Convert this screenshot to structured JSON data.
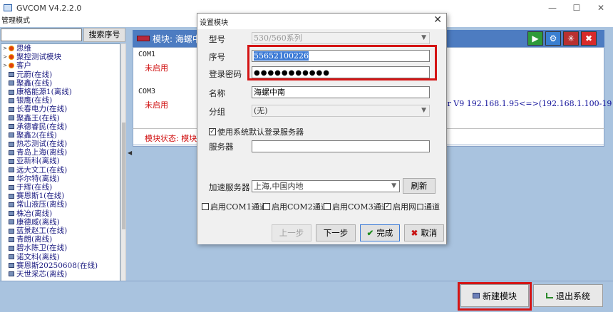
{
  "window": {
    "title": "GVCOM V4.2.2.0",
    "minimize": "—",
    "maximize": "☐",
    "close": "✕"
  },
  "menu": {
    "manage_mode": "管理模式"
  },
  "search": {
    "placeholder": "",
    "button": "搜索序号"
  },
  "tree": {
    "groups": [
      "思维",
      "聚控测试模块",
      "客户"
    ],
    "devices": [
      "元蔚(在线)",
      "聚鑫(在线)",
      "康格能源1(离线)",
      "银鹰(在线)",
      "长春电力(在线)",
      "聚鑫王(在线)",
      "承德睿民(在线)",
      "聚鑫2(在线)",
      "热芯测试(在线)",
      "青岛上海(离线)",
      "亚新科(离线)",
      "远大文工(在线)",
      "华尔特(离线)",
      "于辉(在线)",
      "赛恩斯1(在线)",
      "常山液压(离线)",
      "株冶(离线)",
      "康德威(离线)",
      "蓝景赵工(在线)",
      "青朗(离线)",
      "碧水陈卫(在线)",
      "诺文科(离线)",
      "赛恩斯20250608(在线)",
      "天世采芯(离线)"
    ]
  },
  "module": {
    "title": "模块: 海螺中南",
    "com1": {
      "label": "COM1",
      "state": "未启用"
    },
    "com3": {
      "label": "COM3",
      "state": "未启用",
      "info": "er V9  192.168.1.95<=>(192.168.1.100-19"
    },
    "status": "模块状态: 模块"
  },
  "dialog": {
    "title": "设置模块",
    "model_label": "型号",
    "model_value": "530/560系列",
    "serial_label": "序号",
    "serial_value": "55652100226",
    "password_label": "登录密码",
    "password_value": "●●●●●●●●●●●",
    "name_label": "名称",
    "name_value": "海螺中南",
    "group_label": "分组",
    "group_value": "(无)",
    "use_default_server": "使用系统默认登录服务器",
    "server_label": "服务器",
    "server_value": "",
    "accel_label": "加速服务器",
    "accel_value": "上海,中国内地",
    "refresh_button": "刷新",
    "channels": [
      "启用COM1通道",
      "启用COM2通道",
      "启用COM3通道",
      "启用网口通道"
    ],
    "channels_checked": [
      false,
      false,
      false,
      true
    ],
    "prev_button": "上一步",
    "next_button": "下一步",
    "finish_button": "完成",
    "cancel_button": "取消"
  },
  "bottom": {
    "new_module": "新建模块",
    "exit_system": "退出系统"
  },
  "colors": {
    "client_bg": "#a9c3df",
    "header_blue": "#4d7cc1",
    "highlight_red": "#d41414",
    "offline_text": "#d01010"
  }
}
